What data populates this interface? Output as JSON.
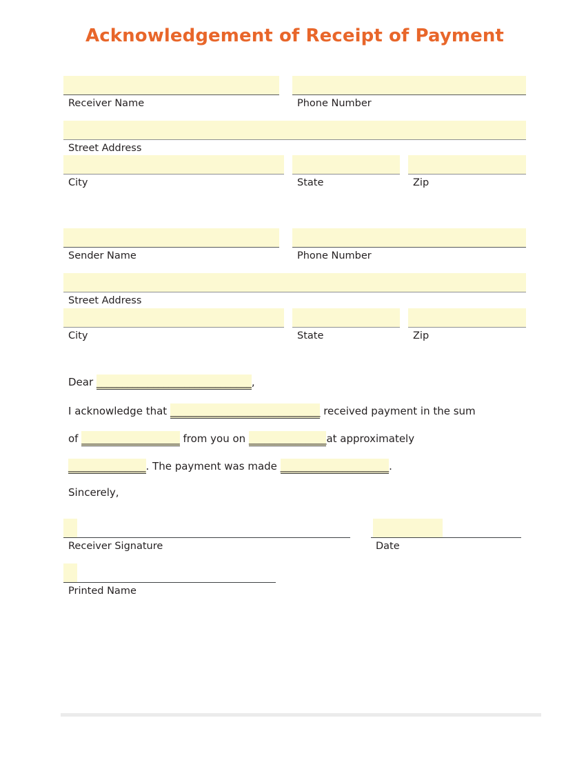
{
  "document": {
    "title": "Acknowledgement of Receipt of Payment",
    "title_color": "#e8662a",
    "field_fill_color": "#fcf9d2",
    "page_background": "#ffffff",
    "footer_divider_color": "#ebebeb"
  },
  "receiver_block": {
    "name_label": "Receiver Name",
    "name_value": "",
    "phone_label": "Phone Number",
    "phone_value": "",
    "street_label": "Street Address",
    "street_value": "",
    "city_label": "City",
    "city_value": "",
    "state_label": "State",
    "state_value": "",
    "zip_label": "Zip",
    "zip_value": ""
  },
  "sender_block": {
    "name_label": "Sender Name",
    "name_value": "",
    "phone_label": "Phone Number",
    "phone_value": "",
    "street_label": "Street Address",
    "street_value": "",
    "city_label": "City",
    "city_value": "",
    "state_label": "State",
    "state_value": "",
    "zip_label": "Zip",
    "zip_value": ""
  },
  "body": {
    "salutation_prefix": "Dear ",
    "salutation_blank": "______________________________",
    "salutation_suffix": ",",
    "line2_prefix": "I acknowledge that ",
    "line2_blank": "_____________________________",
    "line2_suffix": " received payment in the sum",
    "line3_prefix": "of ",
    "line3_blank1": "___________________",
    "line3_mid": " from you on ",
    "line3_blank2": "_______________",
    "line3_suffix": "at approximately",
    "line4_blank1": "_______________",
    "line4_mid": ". The payment was made ",
    "line4_blank2": "_____________________",
    "line4_suffix": ".",
    "closing": "Sincerely,"
  },
  "signature_block": {
    "receiver_signature_label": "Receiver Signature",
    "receiver_signature_value": "",
    "date_label": "Date",
    "date_value": "",
    "printed_name_label": "Printed Name",
    "printed_name_value": ""
  }
}
